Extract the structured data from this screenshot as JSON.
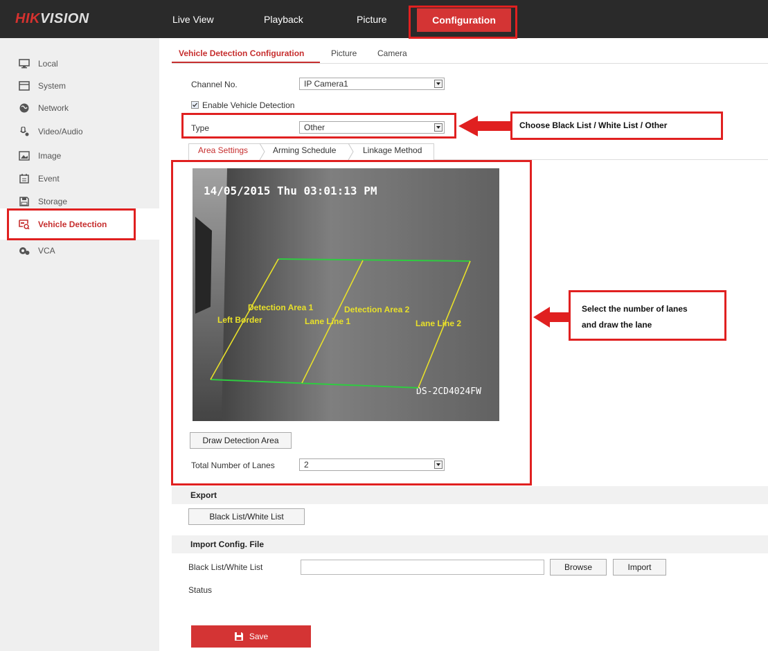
{
  "brand": {
    "logo_red": "HIK",
    "logo_white": "VISION"
  },
  "top_nav": {
    "items": [
      "Live View",
      "Playback",
      "Picture",
      "Configuration"
    ],
    "active": "Configuration"
  },
  "sidebar": {
    "items": [
      {
        "label": "Local",
        "icon": "monitor-icon"
      },
      {
        "label": "System",
        "icon": "system-icon"
      },
      {
        "label": "Network",
        "icon": "globe-icon"
      },
      {
        "label": "Video/Audio",
        "icon": "mic-icon"
      },
      {
        "label": "Image",
        "icon": "image-icon"
      },
      {
        "label": "Event",
        "icon": "calendar-icon"
      },
      {
        "label": "Storage",
        "icon": "storage-icon"
      },
      {
        "label": "Vehicle Detection",
        "icon": "vehicle-detection-icon",
        "active": true
      },
      {
        "label": "VCA",
        "icon": "vca-icon"
      }
    ]
  },
  "tabs": [
    "Vehicle Detection Configuration",
    "Picture",
    "Camera"
  ],
  "form": {
    "channel_label": "Channel No.",
    "channel_value": "IP Camera1",
    "enable_label": "Enable Vehicle Detection",
    "enable_checked": true,
    "type_label": "Type",
    "type_value": "Other"
  },
  "sub_tabs": [
    "Area Settings",
    "Arming Schedule",
    "Linkage Method"
  ],
  "video": {
    "timestamp": "14/05/2015 Thu 03:01:13 PM",
    "camera_name": "DS-2CD4024FW",
    "overlay_labels": {
      "left_border": "Left Border",
      "area1": "Detection Area 1",
      "lane1": "Lane Line 1",
      "area2": "Detection Area 2",
      "lane2": "Lane Line 2"
    }
  },
  "area": {
    "draw_button": "Draw Detection Area",
    "lanes_label": "Total Number of Lanes",
    "lanes_value": "2"
  },
  "export": {
    "title": "Export",
    "button": "Black List/White List"
  },
  "import": {
    "title": "Import Config. File",
    "file_label": "Black List/White List",
    "file_value": "",
    "browse_button": "Browse",
    "import_button": "Import",
    "status_label": "Status"
  },
  "save_button": "Save",
  "callouts": {
    "type_note": "Choose Black List / White List / Other",
    "lanes_note_line1": "Select the number of lanes",
    "lanes_note_line2": "and draw the lane"
  },
  "colors": {
    "accent_red": "#d43434",
    "annotation_red": "#e02020",
    "lane_yellow": "#e8e02a",
    "border_green": "#2ecc40"
  }
}
